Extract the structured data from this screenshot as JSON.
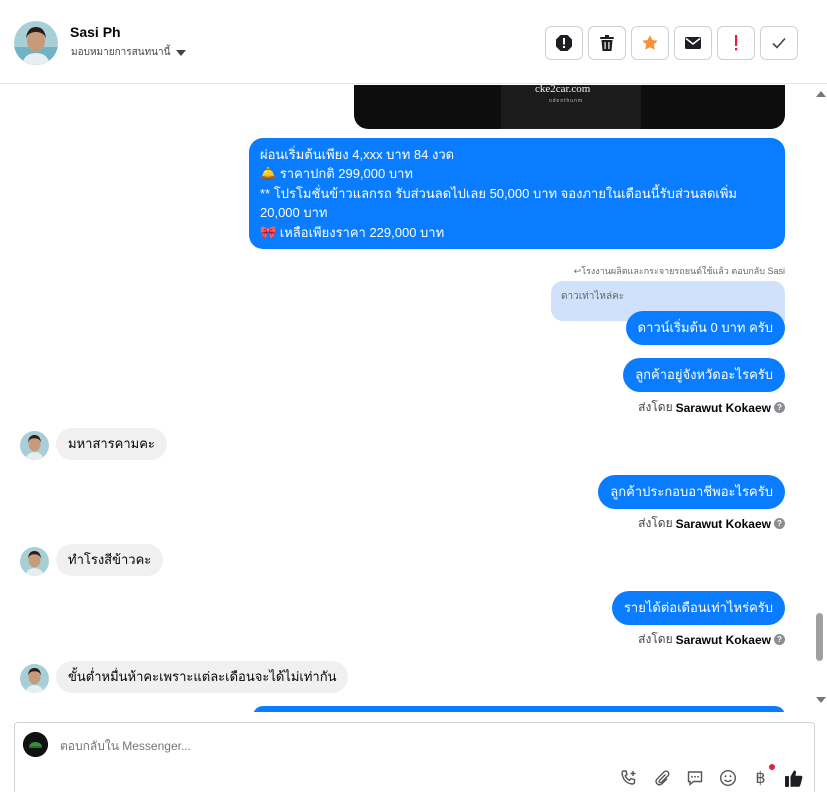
{
  "header": {
    "name": "Sasi Ph",
    "assign_label": "มอบหมายการสนทนานี้"
  },
  "toolbar": {
    "buttons": [
      "spam-icon",
      "trash-icon",
      "star-icon",
      "mark-unread-icon",
      "important-icon",
      "done-icon"
    ],
    "star_color": "#f7923a",
    "important_color": "#e41e3f"
  },
  "thread": {
    "image_caption": "cke2car.com",
    "image_subcaption": "odenthunm",
    "promo_lines": [
      "ผ่อนเริ่มต้นเพียง 4,xxx บาท 84 งวด",
      "🛎️ ราคาปกติ 299,000 บาท",
      "** โปรโมชั่นข้าวแลกรถ รับส่วนลดไปเลย 50,000 บาท จองภายในเดือนนี้รับส่วนลดเพิ่ม",
      "20,000 บาท",
      "🎀  เหลือเพียงราคา 229,000 บาท"
    ],
    "reply_note": "↩โรงงานผลิตและกระจายรถยนต์ใช้แล้ว ตอบกลับ Sasi",
    "quoted_text": "ดาวเท่าไหล่คะ",
    "messages": [
      {
        "side": "out",
        "text": "ดาวน์เริ่มต้น 0 บาท ครับ"
      },
      {
        "side": "out",
        "text": "ลูกค้าอยู่จังหวัดอะไรครับ"
      },
      {
        "side": "in",
        "text": "มหาสารคามคะ"
      },
      {
        "side": "out",
        "text": "ลูกค้าประกอบอาชีพอะไรครับ"
      },
      {
        "side": "in",
        "text": "ทำโรงสีข้าวคะ"
      },
      {
        "side": "out",
        "text": "รายได้ต่อเดือนเท่าไหร่ครับ"
      },
      {
        "side": "in",
        "text": "ขั้นต่ำหมื่นห้าคะเพราะแต่ละเดือนจะได้ไม่เท่ากัน"
      }
    ],
    "sent_by_prefix": "ส่งโดย",
    "sent_by_name": "Sarawut Kokaew",
    "help_glyph": "?"
  },
  "composer": {
    "placeholder": "ตอบกลับใน Messenger...",
    "tools": [
      "call-add-icon",
      "attachment-icon",
      "saved-reply-icon",
      "emoji-icon",
      "payment-icon",
      "like-icon"
    ],
    "baht_symbol": "฿"
  },
  "colors": {
    "bubble_out": "#0a7cff",
    "bubble_in": "#f0f0f0",
    "quote_bg": "#cfe1fb"
  }
}
